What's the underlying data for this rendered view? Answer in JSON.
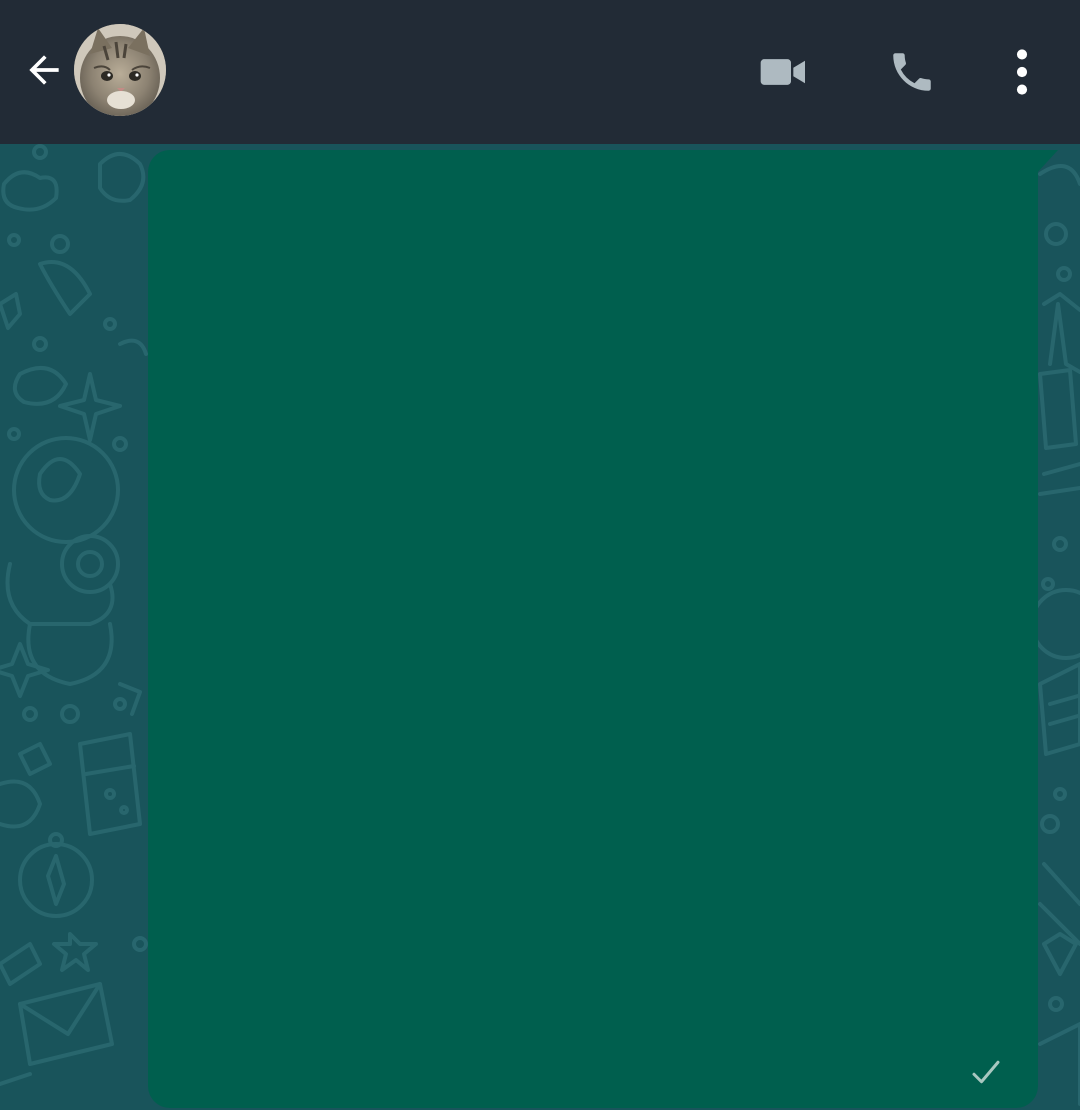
{
  "header": {
    "contact_name": "",
    "back_icon": "arrow-left-icon",
    "avatar_icon": "contact-avatar",
    "video_call_icon": "video-camera-icon",
    "voice_call_icon": "phone-icon",
    "menu_icon": "more-vertical-icon",
    "background_color": "#222b36",
    "icon_color": "#aebac1"
  },
  "conversation": {
    "background_color": "#19545b",
    "messages": [
      {
        "direction": "outgoing",
        "type": "media",
        "status": "sent",
        "status_icon": "single-check-icon",
        "bubble_color": "#005f4e"
      }
    ]
  }
}
